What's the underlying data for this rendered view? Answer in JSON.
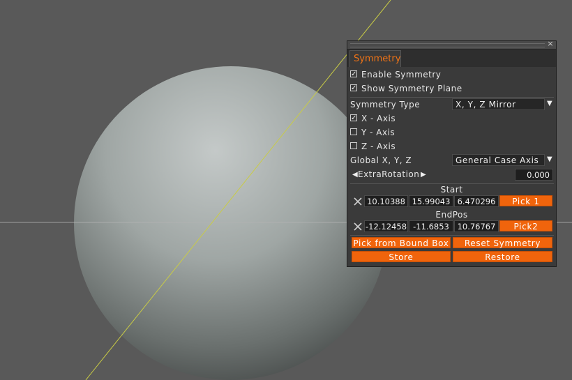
{
  "viewport": {
    "background_color": "#595959",
    "guide_line_color": "#c9cc45",
    "horizon_line_color": "#b0b0b0"
  },
  "panel": {
    "close_glyph": "×",
    "tab_label": "Symmetry",
    "enable_symmetry": {
      "label": "Enable Symmetry",
      "checked": true
    },
    "show_symmetry_plane": {
      "label": "Show Symmetry Plane",
      "checked": true
    },
    "symmetry_type": {
      "label": "Symmetry Type",
      "value": "X, Y, Z Mirror"
    },
    "axes": [
      {
        "label": "X - Axis",
        "checked": true
      },
      {
        "label": "Y - Axis",
        "checked": false
      },
      {
        "label": "Z - Axis",
        "checked": false
      }
    ],
    "global_xyz": {
      "label": "Global X, Y, Z",
      "value": "General Case Axis"
    },
    "extra_rotation": {
      "label": "ExtraRotation",
      "value": "0.000"
    },
    "start": {
      "label": "Start",
      "values": [
        "10.10388",
        "15.99043",
        "6.470296"
      ],
      "pick_label": "Pick 1"
    },
    "end": {
      "label": "EndPos",
      "values": [
        "-12.12458",
        "-11.6853",
        "10.76767"
      ],
      "pick_label": "Pick2"
    },
    "buttons": {
      "pick_bound_box": "Pick from Bound Box",
      "reset_symmetry": "Reset Symmetry",
      "store": "Store",
      "restore": "Restore"
    },
    "accent_color": "#f0640c"
  }
}
